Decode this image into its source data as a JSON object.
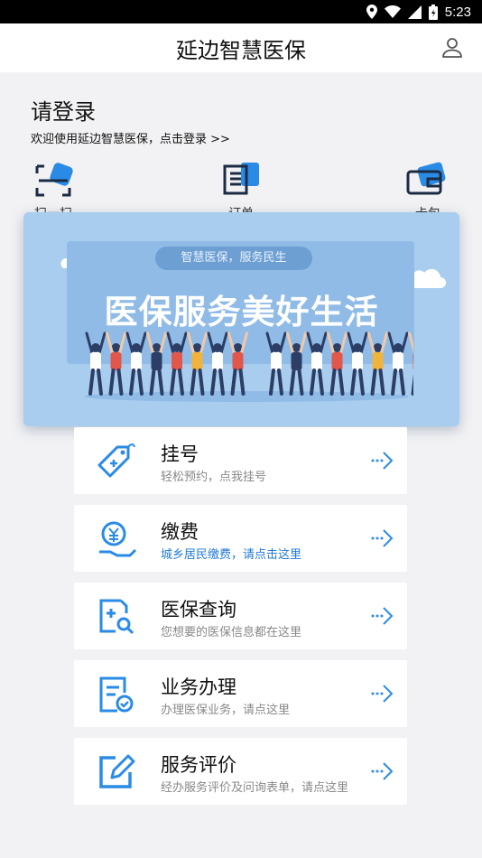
{
  "status_bar": {
    "time": "5:23"
  },
  "header": {
    "title": "延边智慧医保"
  },
  "login": {
    "heading": "请登录",
    "subtitle": "欢迎使用延边智慧医保，点击登录 >>"
  },
  "quick_actions": [
    {
      "label": "扫一扫",
      "icon": "scan-icon"
    },
    {
      "label": "订单",
      "icon": "order-icon"
    },
    {
      "label": "卡包",
      "icon": "wallet-icon"
    }
  ],
  "banner": {
    "tag": "智慧医保，服务民生",
    "slogan": "医保服务美好生活"
  },
  "services": [
    {
      "title": "挂号",
      "subtitle": "轻松预约，点我挂号",
      "icon": "tag-icon"
    },
    {
      "title": "缴费",
      "subtitle": "城乡居民缴费，请点击这里",
      "icon": "payment-icon",
      "highlight": true
    },
    {
      "title": "医保查询",
      "subtitle": "您想要的医保信息都在这里",
      "icon": "search-record-icon"
    },
    {
      "title": "业务办理",
      "subtitle": "办理医保业务，请点这里",
      "icon": "document-check-icon"
    },
    {
      "title": "服务评价",
      "subtitle": "经办服务评价及问询表单，请点这里",
      "icon": "edit-icon"
    }
  ],
  "colors": {
    "accent": "#1f7ad6",
    "icon_blue": "#2a8be6",
    "banner_bg": "#a9cdee"
  }
}
